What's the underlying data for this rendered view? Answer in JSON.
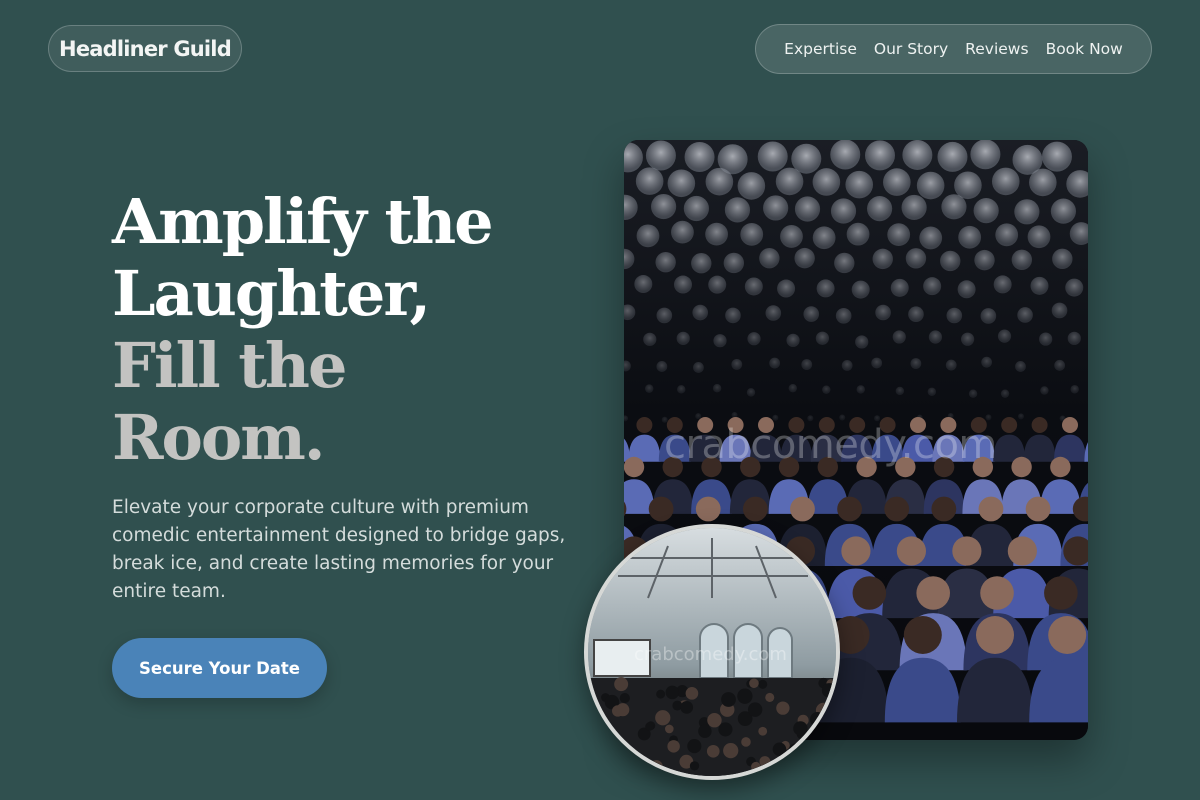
{
  "brand": {
    "name": "Headliner Guild"
  },
  "nav": {
    "items": [
      {
        "label": "Expertise"
      },
      {
        "label": "Our Story"
      },
      {
        "label": "Reviews"
      },
      {
        "label": "Book Now"
      }
    ]
  },
  "hero": {
    "headline_line1": "Amplify the",
    "headline_line2": "Laughter,",
    "headline_line3": "Fill the",
    "headline_line4": "Room.",
    "subtitle": "Elevate your corporate culture with premium comedic entertainment designed to bridge gaps, break ice, and create lasting memories for your entire team.",
    "cta_label": "Secure Your Date"
  },
  "images": {
    "main_alt": "audience seated at a comedy show under bokeh lights",
    "main_watermark": "crabcomedy.com",
    "secondary_alt": "crowded event hall with large arched windows",
    "secondary_watermark": "crabcomedy.com"
  },
  "colors": {
    "background": "#30504f",
    "cta": "#4a83b8",
    "headline_primary": "#ffffff",
    "headline_muted": "#c3c3c1"
  }
}
